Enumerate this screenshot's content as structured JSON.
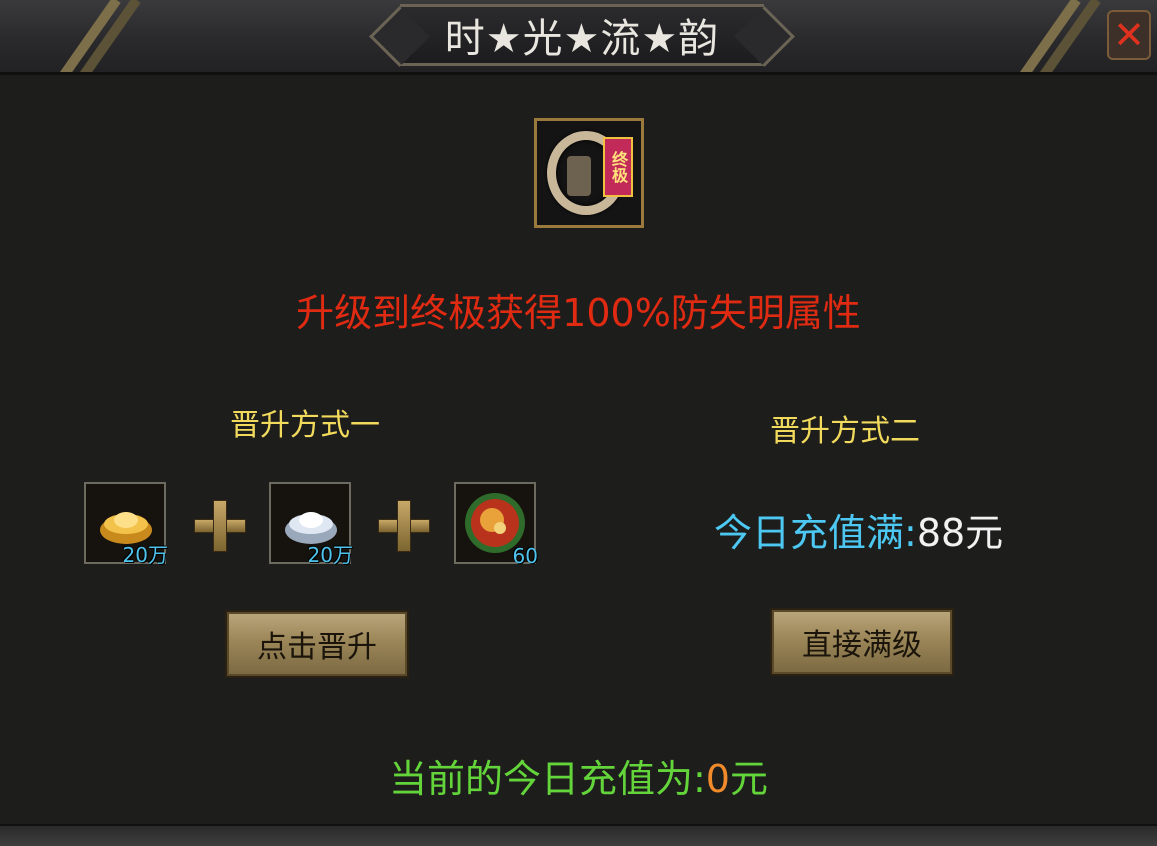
{
  "window": {
    "title": "时★光★流★韵"
  },
  "item": {
    "badge": "终极"
  },
  "headline": "升级到终极获得100%防失明属性",
  "method_one": {
    "label": "晋升方式一",
    "materials": [
      {
        "icon": "gold-ingot-icon",
        "qty": "20万"
      },
      {
        "icon": "silver-ingot-icon",
        "qty": "20万"
      },
      {
        "icon": "dragon-orb-icon",
        "qty": "60"
      }
    ],
    "button_label": "点击晋升"
  },
  "method_two": {
    "label": "晋升方式二",
    "recharge_label": "今日充值满:",
    "recharge_value": "88元",
    "button_label": "直接满级"
  },
  "current_recharge": {
    "label": "当前的今日充值为:",
    "amount": "0",
    "unit": "元"
  },
  "colors": {
    "headline": "#e02a12",
    "method_label": "#f1da5c",
    "recharge_label": "#4cc8f2",
    "current_label": "#63d43a",
    "current_amount": "#f08a2a"
  }
}
